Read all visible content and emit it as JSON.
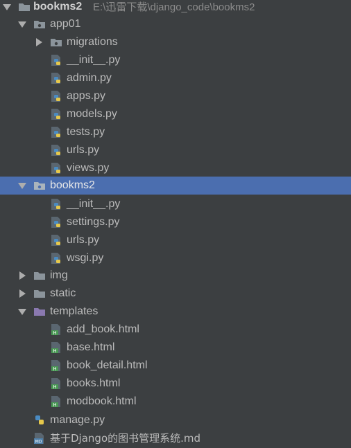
{
  "project": {
    "root_name": "bookms2",
    "root_path": "E:\\迅雷下载\\django_code\\bookms2"
  },
  "tree": {
    "app01": {
      "label": "app01",
      "migrations": "migrations",
      "init": "__init__.py",
      "admin": "admin.py",
      "apps": "apps.py",
      "models": "models.py",
      "tests": "tests.py",
      "urls": "urls.py",
      "views": "views.py"
    },
    "bookms2": {
      "label": "bookms2",
      "init": "__init__.py",
      "settings": "settings.py",
      "urls": "urls.py",
      "wsgi": "wsgi.py"
    },
    "img": "img",
    "static": "static",
    "templates": {
      "label": "templates",
      "add_book": "add_book.html",
      "base": "base.html",
      "book_detail": "book_detail.html",
      "books": "books.html",
      "modbook": "modbook.html"
    },
    "manage": "manage.py",
    "readme": "基于Django的图书管理系统.md"
  },
  "colors": {
    "background": "#3c3f41",
    "selection": "#4b6eaf",
    "folder": "#8b949b",
    "templates_folder": "#8a79b0",
    "python_blue": "#4a8bc2",
    "python_yellow": "#e6c84b",
    "html_green": "#4a9a55",
    "md_blue": "#4f7fa8"
  },
  "icons": {
    "folder": "folder-icon",
    "package": "package-folder-icon",
    "templates": "templates-folder-icon",
    "python": "python-file-icon",
    "html": "html-file-icon",
    "markdown": "markdown-file-icon",
    "expanded": "chevron-down-icon",
    "collapsed": "chevron-right-icon"
  },
  "selected_item": "bookms2"
}
